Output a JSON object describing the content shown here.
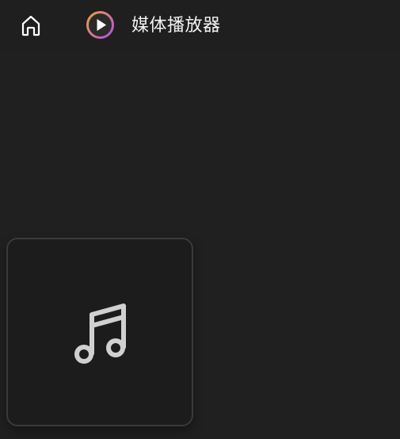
{
  "titlebar": {
    "home_icon": "home-icon",
    "app_icon": "media-player-icon",
    "title": "媒体播放器"
  },
  "media_card": {
    "icon": "music-note-icon"
  },
  "colors": {
    "background": "#202020",
    "titlebar": "#1f1f1f",
    "card_background": "#1c1c1c",
    "card_border": "#3a3a3a",
    "icon_stroke": "#d0d0d0",
    "app_icon_gradient_start": "#f0a040",
    "app_icon_gradient_end": "#b050e0",
    "title_text": "#f2f2f2"
  }
}
